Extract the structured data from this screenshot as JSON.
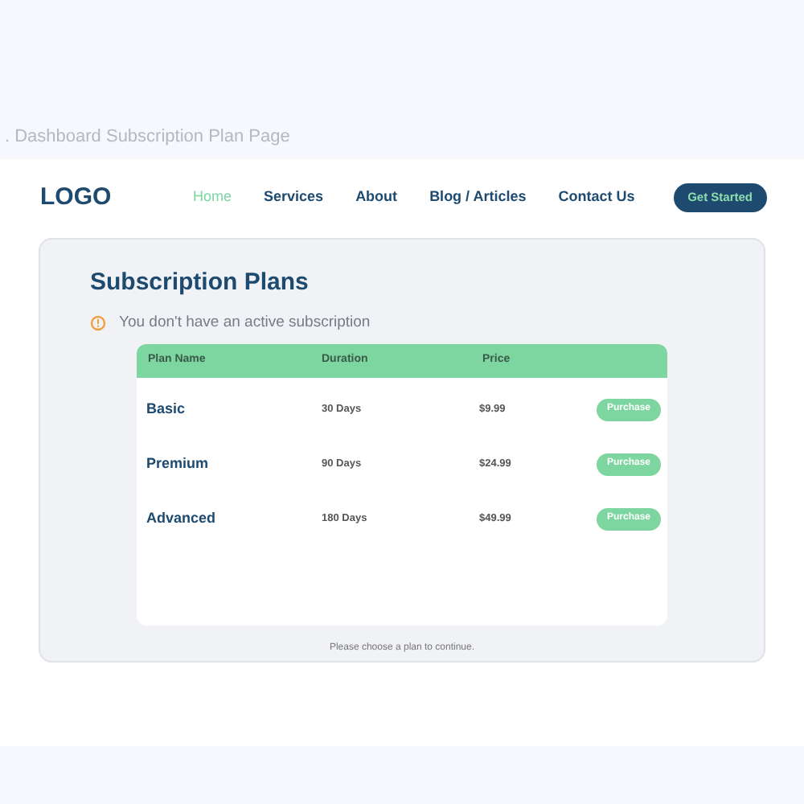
{
  "caption": ". Dashboard Subscription Plan Page",
  "header": {
    "logo": "LOGO",
    "nav": [
      {
        "label": "Home",
        "selected": true
      },
      {
        "label": "Services",
        "selected": false
      },
      {
        "label": "About",
        "selected": false
      },
      {
        "label": "Blog / Articles",
        "selected": false
      },
      {
        "label": "Contact Us",
        "selected": false
      }
    ],
    "cta": "Get Started"
  },
  "page": {
    "title": "Subscription Plans",
    "alert": "You don't have an active subscription",
    "table": {
      "columns": [
        "Plan Name",
        "Duration",
        "Price"
      ],
      "rows": [
        {
          "name": "Basic",
          "duration": "30 Days",
          "price": "$9.99",
          "action": "Purchase"
        },
        {
          "name": "Premium",
          "duration": "90 Days",
          "price": "$24.99",
          "action": "Purchase"
        },
        {
          "name": "Advanced",
          "duration": "180 Days",
          "price": "$49.99",
          "action": "Purchase"
        }
      ]
    },
    "footer_note": "Please choose a plan to continue."
  }
}
